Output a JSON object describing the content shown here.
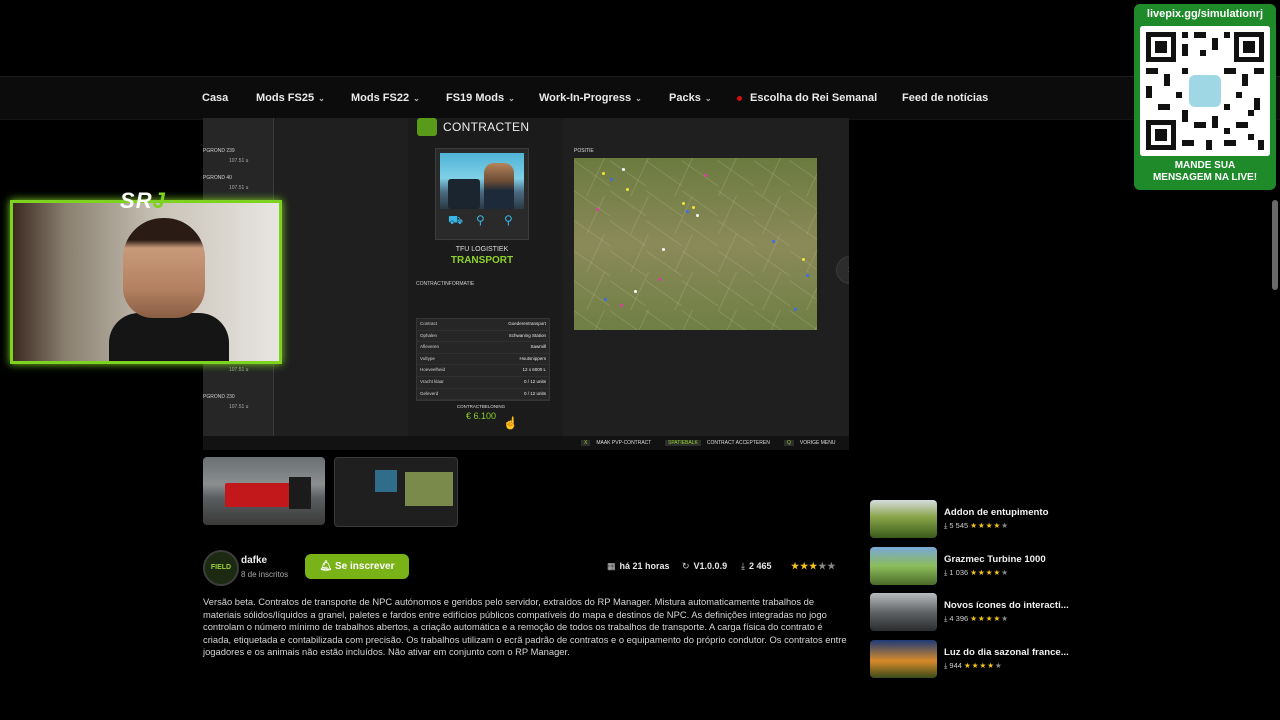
{
  "nav": {
    "items": [
      {
        "label": "Casa",
        "chevron": false
      },
      {
        "label": "Mods FS25",
        "chevron": true
      },
      {
        "label": "Mods FS22",
        "chevron": true
      },
      {
        "label": "FS19 Mods",
        "chevron": true
      },
      {
        "label": "Work-In-Progress",
        "chevron": true
      },
      {
        "label": "Packs",
        "chevron": true
      },
      {
        "label": "Escolha do Rei Semanal",
        "chevron": false,
        "dot": true
      },
      {
        "label": "Feed de notícias",
        "chevron": false
      }
    ],
    "chevron_glyph": "⌄"
  },
  "screenshot": {
    "title": "CONTRACTEN",
    "left_rows": [
      "PGROND 239",
      "107.51 u",
      "PGROND 40",
      "107.51 u",
      "107.51 u",
      "PGROND 230",
      "107.51 u"
    ],
    "company": "TFU LOGISTIEK",
    "company_type": "TRANSPORT",
    "info_label": "CONTRACTINFORMATIE",
    "map_label": "POSITIE",
    "table": [
      {
        "key": "Contract",
        "value": "Goederentransport"
      },
      {
        "key": "Ophalen",
        "value": "Schwaning Station"
      },
      {
        "key": "Afleveren",
        "value": "Sawmill"
      },
      {
        "key": "Vultype",
        "value": "Houtsnippers"
      },
      {
        "key": "Hoeveelheid",
        "value": "12 x 6000 L"
      },
      {
        "key": "Vracht klaar",
        "value": "0 / 12 units"
      },
      {
        "key": "Geleverd",
        "value": "0 / 12 units"
      }
    ],
    "reward_label": "CONTRACTBELONING",
    "reward_value": "€ 6.100",
    "footer": [
      {
        "key": "X",
        "label": "MAAK PVP-CONTRACT"
      },
      {
        "key": "SPATIEBALK",
        "label": "CONTRACT ACCEPTEREN"
      },
      {
        "key": "Q",
        "label": "VORIGE MENU"
      }
    ],
    "next_glyph": "›"
  },
  "author": {
    "avatar_text": "FIELD",
    "name": "dafke",
    "subscribers": "8 de inscritos",
    "subscribe_label": "Se inscrever"
  },
  "meta": {
    "time": "há 21 horas",
    "version": "V1.0.0.9",
    "downloads": "2 465",
    "rating": 3
  },
  "description": "Versão beta. Contratos de transporte de NPC autónomos e geridos pelo servidor, extraídos do RP Manager. Mistura automaticamente trabalhos de materiais sólidos/líquidos a granel, paletes e fardos entre edifícios públicos compatíveis do mapa e destinos de NPC. As definições integradas no jogo controlam o número mínimo de trabalhos abertos, a criação automática e a remoção de todos os trabalhos de transporte. A carga física do contrato é criada, etiquetada e contabilizada com precisão. Os trabalhos utilizam o ecrã padrão de contratos e o equipamento do próprio condutor. Os contratos entre jogadores e os animais não estão incluídos. Não ativar em conjunto com o RP Manager.",
  "related": [
    {
      "title": "Addon de entupimento",
      "downloads": "5 545",
      "rating": 4
    },
    {
      "title": "Grazmec Turbine 1000",
      "downloads": "1 036",
      "rating": 4
    },
    {
      "title": "Novos ícones do interacti...",
      "downloads": "4 396",
      "rating": 4
    },
    {
      "title": "Luz do dia sazonal france...",
      "downloads": "944",
      "rating": 4
    }
  ],
  "overlay": {
    "logo_s": "S",
    "logo_r": "R",
    "logo_j": "J",
    "qr_url": "livepix.gg/simulationrj",
    "qr_cta_line1": "MANDE SUA",
    "qr_cta_line2": "MENSAGEM NA LIVE!"
  },
  "colors": {
    "accent_green": "#7ab317",
    "reward_green": "#8fd12a",
    "webcam_border": "#7ed321",
    "qr_green": "#1e8a2a",
    "star": "#f2c318"
  }
}
